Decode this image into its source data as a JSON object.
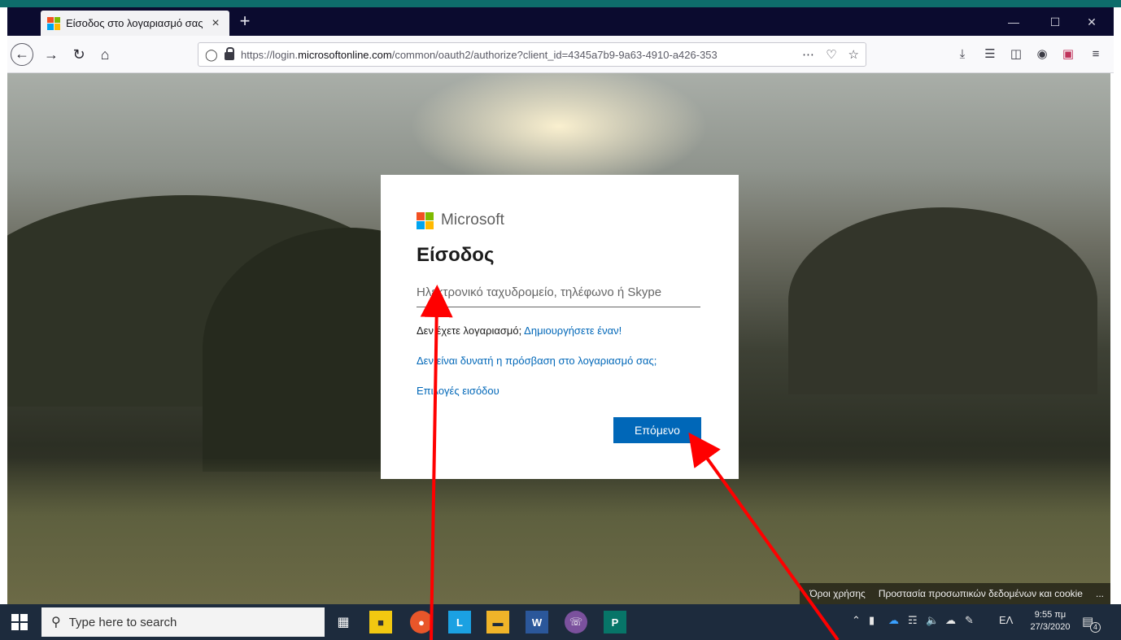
{
  "browser": {
    "tab_title": "Είσοδος στο λογαριασμό σας",
    "new_tab_symbol": "+",
    "tab_close_symbol": "×",
    "url_prefix": "https://login.",
    "url_domain": "microsoftonline.com",
    "url_path": "/common/oauth2/authorize?client_id=4345a7b9-9a63-4910-a426-353",
    "icons": [
      "back-arrow-icon",
      "forward-arrow-icon",
      "reload-icon",
      "home-icon",
      "shield-icon",
      "lock-icon",
      "more-icon",
      "pocket-icon",
      "star-icon",
      "download-icon",
      "library-icon",
      "sidebar-icon",
      "account-icon",
      "pocket-extension-icon",
      "menu-icon"
    ]
  },
  "login": {
    "brand": "Microsoft",
    "title": "Είσοδος",
    "email_placeholder": "Ηλεκτρονικό ταχυδρομείο, τηλέφωνο ή Skype",
    "no_account_text": "Δεν έχετε λογαριασμό;",
    "create_link": "Δημιουργήσετε έναν!",
    "cant_access_link": "Δεν είναι δυνατή η πρόσβαση στο λογαριασμό σας;",
    "signin_options_link": "Επιλογές εισόδου",
    "next_button": "Επόμενο"
  },
  "footer": {
    "terms": "Όροι χρήσης",
    "privacy": "Προστασία προσωπικών δεδομένων και cookie",
    "more": "..."
  },
  "taskbar": {
    "search_placeholder": "Type here to search",
    "language": "ΕΛ",
    "time": "9:55 πμ",
    "date": "27/3/2020",
    "notification_count": "4"
  },
  "colors": {
    "accent": "#0067b8",
    "ms_red": "#f25022",
    "ms_green": "#7fba00",
    "ms_blue": "#00a4ef",
    "ms_yellow": "#ffb900",
    "arrow": "#ff0000"
  }
}
